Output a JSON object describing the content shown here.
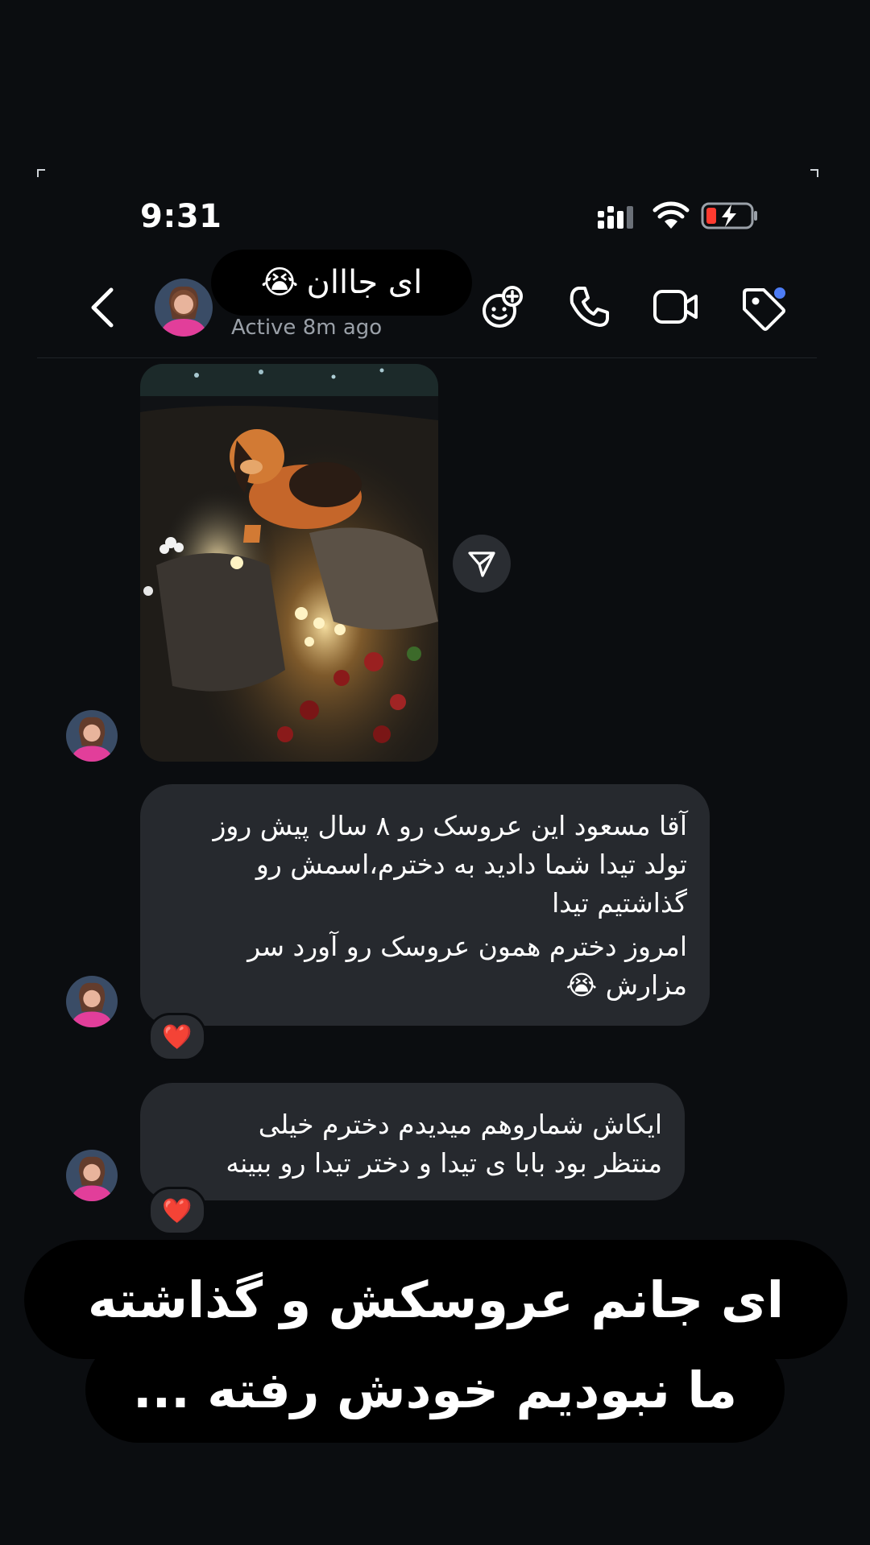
{
  "status_bar": {
    "time": "9:31"
  },
  "header": {
    "title": "ای جااان",
    "title_emoji": "😭",
    "active_status": "Active 8m ago",
    "icons": [
      "back-icon",
      "effects-icon",
      "phone-icon",
      "video-icon",
      "tag-icon"
    ]
  },
  "messages": [
    {
      "type": "photo",
      "description_icon": "share-icon"
    },
    {
      "type": "text",
      "lines": [
        "آقا مسعود این عروسک رو ۸ سال پیش روز",
        "تولد تیدا شما دادید به دخترم،اسمش رو",
        "گذاشتیم تیدا",
        "امروز دخترم همون عروسک رو آورد سر",
        "مزارش 😭"
      ],
      "reaction": "❤️"
    },
    {
      "type": "text",
      "lines": [
        "ایکاش شماروهم میدیدم دخترم خیلی",
        "منتظر بود بابا ی تیدا و دختر تیدا رو ببینه"
      ],
      "reaction": "❤️"
    }
  ],
  "caption": {
    "line1": "ای جانم عروسکش و گذاشته",
    "line2": "ما نبودیم خودش رفته ..."
  },
  "colors": {
    "background": "#0b0d10",
    "bubble": "#26292e",
    "notification_dot": "#4d7cf5",
    "battery_red": "#ff3b30"
  }
}
